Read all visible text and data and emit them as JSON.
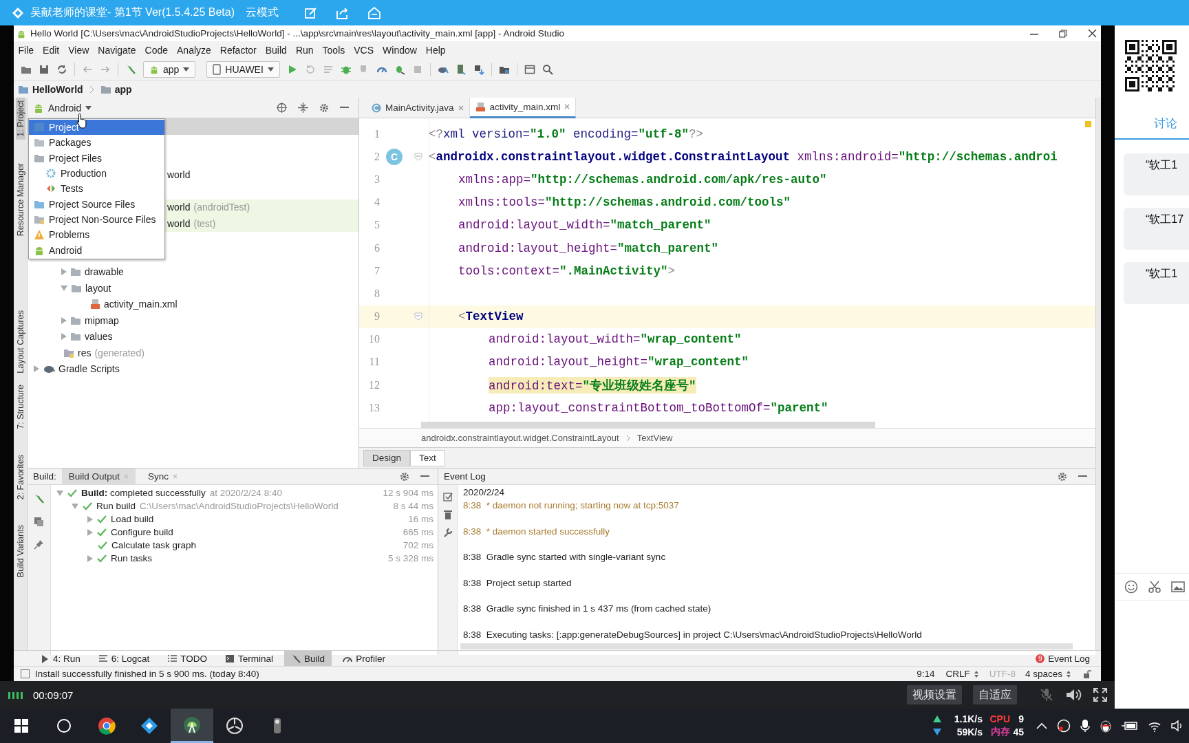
{
  "topbar": {
    "title": "吴献老师的课堂- 第1节 Ver(1.5.4.25 Beta)",
    "mode": "云模式"
  },
  "ide": {
    "title": "Hello World [C:\\Users\\mac\\AndroidStudioProjects\\HelloWorld] - ...\\app\\src\\main\\res\\layout\\activity_main.xml [app] - Android Studio",
    "menu": [
      "File",
      "Edit",
      "View",
      "Navigate",
      "Code",
      "Analyze",
      "Refactor",
      "Build",
      "Run",
      "Tools",
      "VCS",
      "Window",
      "Help"
    ],
    "toolbar": {
      "config": "app",
      "device": "HUAWEI"
    },
    "breadcrumb": [
      "HelloWorld",
      "app"
    ],
    "tool_strip": [
      {
        "label": "1: Project",
        "selected": true
      },
      {
        "label": "Resource Manager",
        "selected": false
      },
      {
        "label": "Layout Captures",
        "selected": false
      },
      {
        "label": "7: Structure",
        "selected": false
      },
      {
        "label": "2: Favorites",
        "selected": false
      },
      {
        "label": "Build Variants",
        "selected": false
      }
    ],
    "project_panel": {
      "view": "Android",
      "tree": [
        {
          "text": "world",
          "kind": "package",
          "highlight": false
        },
        {
          "text": "world",
          "suffix": "(androidTest)",
          "kind": "package",
          "highlight": true
        },
        {
          "text": "world",
          "suffix": "(test)",
          "kind": "package",
          "highlight": true
        },
        {
          "text": "drawable",
          "kind": "folder",
          "expanded": false,
          "highlight": false
        },
        {
          "text": "layout",
          "kind": "folder",
          "expanded": true,
          "highlight": false
        },
        {
          "text": "activity_main.xml",
          "kind": "file",
          "highlight": false
        },
        {
          "text": "mipmap",
          "kind": "folder",
          "expanded": false,
          "highlight": false
        },
        {
          "text": "values",
          "kind": "folder",
          "expanded": false,
          "highlight": false
        },
        {
          "text": "res",
          "suffix": "(generated)",
          "kind": "res",
          "highlight": false
        },
        {
          "text": "Gradle Scripts",
          "kind": "gradle",
          "expanded": false,
          "highlight": false
        }
      ],
      "view_menu": [
        {
          "label": "Project",
          "kind": "project",
          "selected": true
        },
        {
          "label": "Packages",
          "kind": "packages",
          "selected": false
        },
        {
          "label": "Project Files",
          "kind": "files",
          "selected": false
        },
        {
          "label": "Production",
          "kind": "production",
          "selected": false
        },
        {
          "label": "Tests",
          "kind": "tests",
          "selected": false
        },
        {
          "label": "Project Source Files",
          "kind": "source",
          "selected": false
        },
        {
          "label": "Project Non-Source Files",
          "kind": "nonsource",
          "selected": false
        },
        {
          "label": "Problems",
          "kind": "problems",
          "selected": false
        },
        {
          "label": "Android",
          "kind": "android",
          "selected": false
        }
      ]
    },
    "editor": {
      "tabs": [
        {
          "label": "MainActivity.java",
          "kind": "java",
          "selected": false
        },
        {
          "label": "activity_main.xml",
          "kind": "xml",
          "selected": true
        }
      ],
      "lines": [
        {
          "number": "1",
          "kind": "root",
          "current": false,
          "fold": false,
          "segments": [
            {
              "kind": "punct",
              "t": "<?"
            },
            {
              "kind": "prolog",
              "t": "xml version="
            },
            {
              "kind": "value",
              "t": "\"1.0\""
            },
            {
              "kind": "prolog",
              "t": " encoding="
            },
            {
              "kind": "value",
              "t": "\"utf-8\""
            },
            {
              "kind": "punct",
              "t": "?>"
            }
          ]
        },
        {
          "number": "2",
          "kind": "root",
          "current": false,
          "fold": true,
          "badge": "C",
          "segments": [
            {
              "kind": "punct",
              "t": "<"
            },
            {
              "kind": "tag",
              "t": "androidx.constraintlayout.widget.ConstraintLayout"
            },
            {
              "kind": "attr",
              "t": " xmlns:android="
            },
            {
              "kind": "value",
              "t": "\"http://schemas.androi"
            }
          ]
        },
        {
          "number": "3",
          "kind": "attr",
          "current": false,
          "fold": false,
          "segments": [
            {
              "kind": "attr",
              "t": "xmlns:app="
            },
            {
              "kind": "value",
              "t": "\"http://schemas.android.com/apk/res-auto\""
            }
          ]
        },
        {
          "number": "4",
          "kind": "attr",
          "current": false,
          "fold": false,
          "segments": [
            {
              "kind": "attr",
              "t": "xmlns:tools="
            },
            {
              "kind": "value",
              "t": "\"http://schemas.android.com/tools\""
            }
          ]
        },
        {
          "number": "5",
          "kind": "attr",
          "current": false,
          "fold": false,
          "segments": [
            {
              "kind": "attr",
              "t": "android:layout_width="
            },
            {
              "kind": "value",
              "t": "\"match_parent\""
            }
          ]
        },
        {
          "number": "6",
          "kind": "attr",
          "current": false,
          "fold": false,
          "segments": [
            {
              "kind": "attr",
              "t": "android:layout_height="
            },
            {
              "kind": "value",
              "t": "\"match_parent\""
            }
          ]
        },
        {
          "number": "7",
          "kind": "attr",
          "current": false,
          "fold": false,
          "segments": [
            {
              "kind": "attr",
              "t": "tools:context="
            },
            {
              "kind": "value",
              "t": "\".MainActivity\""
            },
            {
              "kind": "punct",
              "t": ">"
            }
          ]
        },
        {
          "number": "8",
          "kind": "blank",
          "current": false,
          "fold": false
        },
        {
          "number": "9",
          "kind": "child",
          "current": true,
          "fold": true,
          "segments": [
            {
              "kind": "punct",
              "t": "<"
            },
            {
              "kind": "tag",
              "t": "TextView"
            }
          ]
        },
        {
          "number": "10",
          "kind": "child-attr",
          "current": false,
          "fold": false,
          "segments": [
            {
              "kind": "attr",
              "t": "android:layout_width="
            },
            {
              "kind": "value",
              "t": "\"wrap_content\""
            }
          ]
        },
        {
          "number": "11",
          "kind": "child-attr",
          "current": false,
          "fold": false,
          "segments": [
            {
              "kind": "attr",
              "t": "android:layout_height="
            },
            {
              "kind": "value",
              "t": "\"wrap_content\""
            }
          ]
        },
        {
          "number": "12",
          "kind": "child-attr",
          "current": false,
          "highlighted": true,
          "fold": false,
          "segments": [
            {
              "kind": "attr",
              "t": "android:text="
            },
            {
              "kind": "value",
              "t": "\"专业班级姓名座号\""
            }
          ]
        },
        {
          "number": "13",
          "kind": "child-attr",
          "current": false,
          "fold": false,
          "segments": [
            {
              "kind": "attr",
              "t": "app:layout_constraintBottom_toBottomOf="
            },
            {
              "kind": "value",
              "t": "\"parent\""
            }
          ]
        }
      ],
      "breadcrumb": [
        "androidx.constraintlayout.widget.ConstraintLayout",
        "TextView"
      ],
      "mode_tabs": [
        {
          "label": "Design",
          "selected": false
        },
        {
          "label": "Text",
          "selected": true
        }
      ]
    },
    "build": {
      "title": "Build:",
      "tabs": [
        {
          "label": "Build Output",
          "selected": true
        },
        {
          "label": "Sync",
          "selected": false
        }
      ],
      "rows": [
        {
          "text": "**Build:** completed successfully",
          "detail": "at 2020/2/24 8:40",
          "time": "12 s 904 ms",
          "expanded": true,
          "children": [
            {
              "text": "Run build",
              "detail": "C:\\Users\\mac\\AndroidStudioProjects\\HelloWorld",
              "time": "8 s 44 ms",
              "expanded": true,
              "children": [
                {
                  "text": "Load build",
                  "time": "16 ms",
                  "expanded": false
                },
                {
                  "text": "Configure build",
                  "time": "665 ms",
                  "expanded": false
                },
                {
                  "text": "Calculate task graph",
                  "time": "702 ms"
                },
                {
                  "text": "Run tasks",
                  "time": "5 s 328 ms",
                  "expanded": false
                }
              ]
            }
          ]
        }
      ]
    },
    "event_log": {
      "title": "Event Log",
      "date": "2020/2/24",
      "entries": [
        {
          "time": "8:38",
          "message": "* daemon not running; starting now at tcp:5037",
          "kind": "warning"
        },
        {
          "time": "8:38",
          "message": "* daemon started successfully",
          "kind": "warning"
        },
        {
          "time": "8:38",
          "message": "Gradle sync started with single-variant sync",
          "kind": "info"
        },
        {
          "time": "8:38",
          "message": "Project setup started",
          "kind": "info"
        },
        {
          "time": "8:38",
          "message": "Gradle sync finished in 1 s 437 ms (from cached state)",
          "kind": "info"
        },
        {
          "time": "8:38",
          "message": "Executing tasks: [:app:generateDebugSources] in project C:\\Users\\mac\\AndroidStudioProjects\\HelloWorld",
          "kind": "info"
        }
      ]
    },
    "tool_tabs": [
      {
        "label": "4: Run",
        "kind": "run",
        "selected": false
      },
      {
        "label": "6: Logcat",
        "kind": "logcat",
        "selected": false
      },
      {
        "label": "TODO",
        "kind": "todo",
        "selected": false
      },
      {
        "label": "Terminal",
        "kind": "terminal",
        "selected": false
      },
      {
        "label": "Build",
        "kind": "build",
        "selected": true
      },
      {
        "label": "Profiler",
        "kind": "profiler",
        "selected": false
      }
    ],
    "event_log_button": {
      "label": "Event Log",
      "badge": "9"
    },
    "status": {
      "message": "Install successfully finished in 5 s 900 ms. (today 8:40)",
      "position": "9:14",
      "line_separator": "CRLF",
      "encoding": "UTF-8",
      "indent": "4 spaces"
    }
  },
  "side": {
    "tab": {
      "label": "讨论",
      "selected": true
    },
    "messages": [
      "“软工1",
      "“软工17",
      "“软工1"
    ]
  },
  "video_bar": {
    "elapsed": "00:09:07",
    "buttons": [
      "视频设置",
      "自适应"
    ]
  },
  "taskbar": {
    "apps": [
      {
        "kind": "browser",
        "selected": false
      },
      {
        "kind": "diamond",
        "selected": false
      },
      {
        "kind": "android",
        "selected": true
      },
      {
        "kind": "aperture",
        "selected": false
      },
      {
        "kind": "figure",
        "selected": false
      }
    ],
    "upload": "1.1K/s",
    "cpu_label": "CPU",
    "cpu": "9",
    "download": "59K/s",
    "mem_label": "内存",
    "mem": "45"
  }
}
